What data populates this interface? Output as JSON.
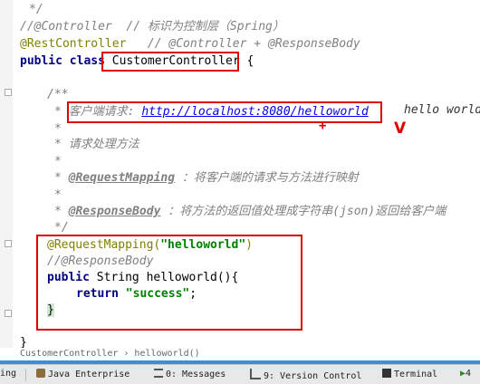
{
  "code": {
    "l1": "*/",
    "l2_code": "//@Controller",
    "l2_comment": "// 标识为控制层（Spring）",
    "l3_code": "@RestController",
    "l3_comment": "// @Controller + @ResponseBody",
    "l4_public": "public",
    "l4_class": "class",
    "l4_name": "CustomerController",
    "l4_brace": "{",
    "l6": "/**",
    "l7_star": "*",
    "l7_label": "客户端请求:",
    "l7_url": "http://localhost:8080/helloworld",
    "l8": "*",
    "l9_star": "*",
    "l9_text": "请求处理方法",
    "l10": "*",
    "l11_star": "*",
    "l11_tag": "@RequestMapping",
    "l11_text": "：将客户端的请求与方法进行映射",
    "l12": "*",
    "l13_star": "*",
    "l13_tag": "@ResponseBody",
    "l13_text": "：将方法的返回值处理成字符串(json)返回给客户端",
    "l14": "*/",
    "l15_ann": "@RequestMapping(",
    "l15_str": "\"helloworld\"",
    "l15_close": ")",
    "l16": "//@ResponseBody",
    "l17_public": "public",
    "l17_rest": "String helloworld(){",
    "l18_return": "return",
    "l18_str": "\"success\"",
    "l18_semi": ";",
    "l19": "}",
    "l21": "}"
  },
  "annotation_text": "hello  world",
  "plus_mark": "+",
  "v_mark": "V",
  "breadcrumb": "CustomerController › helloworld()",
  "statusbar": {
    "item0": "ing",
    "item1": "Java Enterprise",
    "item2": "0: Messages",
    "item3": "9: Version Control",
    "item4": "Terminal",
    "item5": "4"
  },
  "colors": {
    "highlight_box": "#e00000",
    "keyword": "#000080",
    "annotation": "#808000",
    "string": "#008000",
    "link": "#0000ee"
  }
}
